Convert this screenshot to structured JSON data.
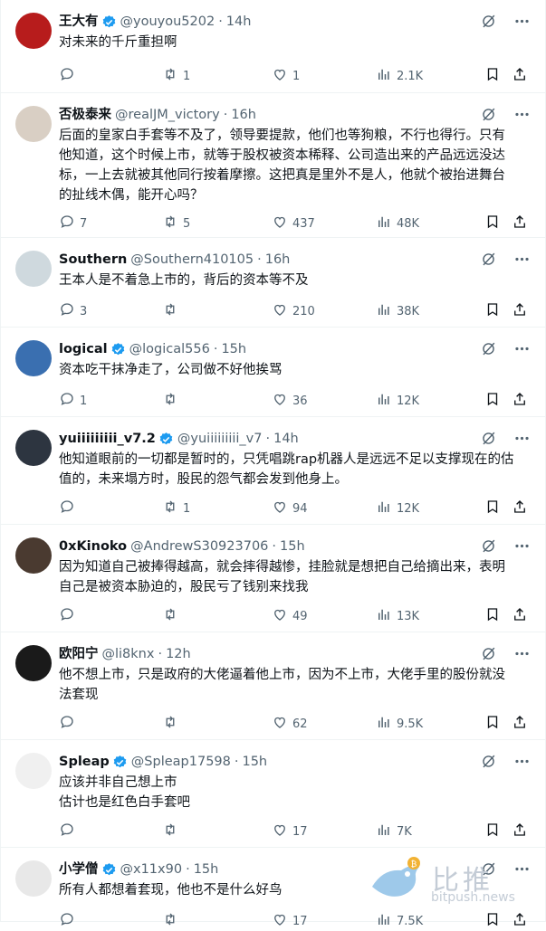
{
  "tweets": [
    {
      "name": "王大有",
      "verified": true,
      "handle": "@youyou5202",
      "time": "14h",
      "text": "对未来的千斤重担啊",
      "replies": "",
      "retweets": "1",
      "likes": "1",
      "views": "2.1K",
      "avatar_color": "#b71c1c"
    },
    {
      "name": "否极泰来",
      "verified": false,
      "handle": "@realJM_victory",
      "time": "16h",
      "text": "后面的皇家白手套等不及了，领导要提款，他们也等狗粮，不行也得行。只有\n他知道，这个时候上市，就等于股权被资本稀释、公司造出来的产品远远没达\n标，一上去就被其他同行按着摩擦。这把真是里外不是人，他就个被抬进舞台\n的扯线木偶，能开心吗？",
      "replies": "7",
      "retweets": "5",
      "likes": "437",
      "views": "48K",
      "avatar_color": "#d9cfc4"
    },
    {
      "name": "Southern",
      "verified": false,
      "handle": "@Southern410105",
      "time": "16h",
      "text": "王本人是不着急上市的，背后的资本等不及",
      "replies": "3",
      "retweets": "",
      "likes": "210",
      "views": "38K",
      "avatar_color": "#cfd9de"
    },
    {
      "name": "logical",
      "verified": true,
      "handle": "@logical556",
      "time": "15h",
      "text": "资本吃干抹净走了，公司做不好他挨骂",
      "replies": "1",
      "retweets": "",
      "likes": "36",
      "views": "12K",
      "avatar_color": "#3a6fb0"
    },
    {
      "name": "yuiiiiiiiii_v7.2",
      "verified": true,
      "handle": "@yuiiiiiiiii_v7",
      "time": "14h",
      "text": "他知道眼前的一切都是暂时的，只凭唱跳rap机器人是远远不足以支撑现在的估\n值的，未来塌方时，股民的怨气都会发到他身上。",
      "replies": "",
      "retweets": "1",
      "likes": "94",
      "views": "12K",
      "avatar_color": "#2d3540"
    },
    {
      "name": "0xKinoko",
      "verified": false,
      "handle": "@AndrewS30923706",
      "time": "15h",
      "text": "因为知道自己被捧得越高，就会摔得越惨，挂脸就是想把自己给摘出来，表明\n自己是被资本胁迫的，股民亏了钱别来找我",
      "replies": "",
      "retweets": "",
      "likes": "49",
      "views": "13K",
      "avatar_color": "#4a3a30"
    },
    {
      "name": "欧阳宁",
      "verified": false,
      "handle": "@li8knx",
      "time": "12h",
      "text": "他不想上市，只是政府的大佬逼着他上市，因为不上市，大佬手里的股份就没\n法套现",
      "replies": "",
      "retweets": "",
      "likes": "62",
      "views": "9.5K",
      "avatar_color": "#1a1a1a"
    },
    {
      "name": "Spleap",
      "verified": true,
      "handle": "@Spleap17598",
      "time": "15h",
      "text": "应该并非自己想上市\n估计也是红色白手套吧",
      "replies": "",
      "retweets": "",
      "likes": "17",
      "views": "7K",
      "avatar_color": "#f0f0f0"
    },
    {
      "name": "小学僧",
      "verified": true,
      "handle": "@x11x90",
      "time": "15h",
      "text": "所有人都想着套现，他也不是什么好鸟",
      "replies": "",
      "retweets": "",
      "likes": "17",
      "views": "7.5K",
      "avatar_color": "#e8e8e8"
    }
  ],
  "watermark": {
    "cn": "比推",
    "url": "bitpush.news"
  },
  "colors": {
    "text": "#0f1419",
    "secondary": "#536471",
    "verified": "#1d9bf0",
    "divider": "#eff3f4"
  }
}
